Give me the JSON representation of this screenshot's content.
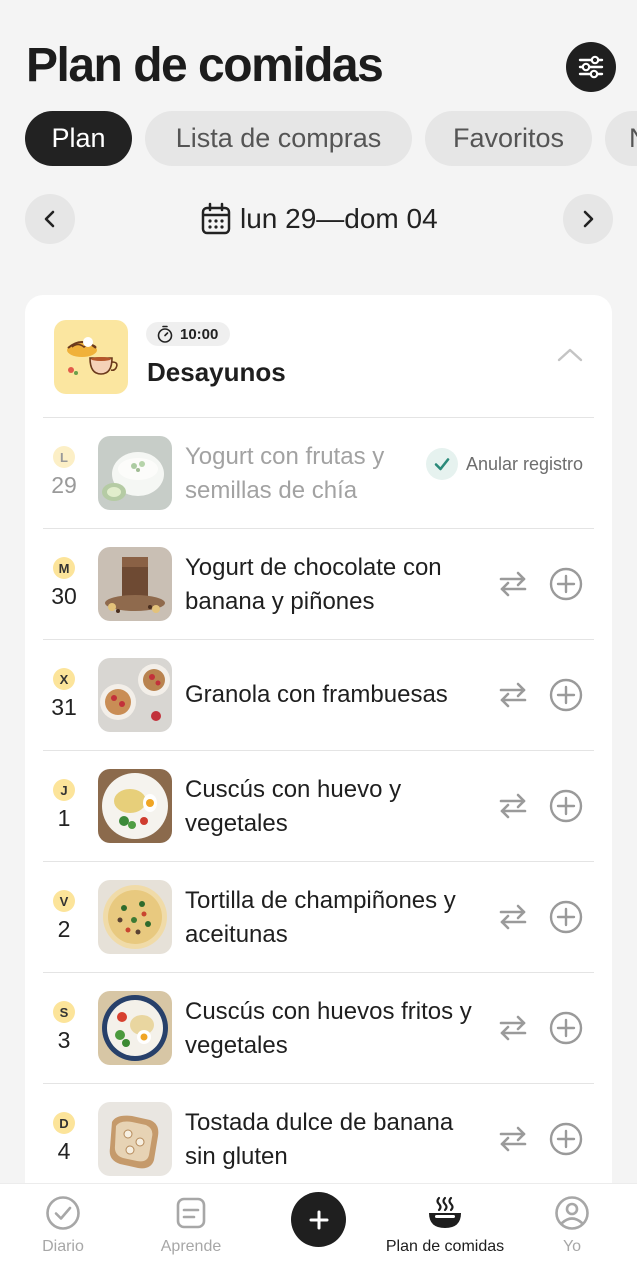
{
  "header": {
    "title": "Plan de comidas",
    "filter_icon": "sliders-icon"
  },
  "tabs": [
    {
      "label": "Plan",
      "active": true
    },
    {
      "label": "Lista de compras",
      "active": false
    },
    {
      "label": "Favoritos",
      "active": false
    },
    {
      "label": "N",
      "active": false
    }
  ],
  "week": {
    "label": "lun 29—dom 04",
    "icon": "calendar-icon"
  },
  "meal": {
    "time": "10:00",
    "name": "Desayunos",
    "icon": "breakfast-illustration"
  },
  "rows": [
    {
      "day": "L",
      "num": "29",
      "name": "Yogurt con frutas y semillas de chía",
      "logged": true,
      "undo_label": "Anular registro"
    },
    {
      "day": "M",
      "num": "30",
      "name": "Yogurt de chocolate con banana y piñones",
      "logged": false
    },
    {
      "day": "X",
      "num": "31",
      "name": "Granola con frambuesas",
      "logged": false
    },
    {
      "day": "J",
      "num": "1",
      "name": "Cuscús con huevo y vegetales",
      "logged": false
    },
    {
      "day": "V",
      "num": "2",
      "name": "Tortilla de champiñones y aceitunas",
      "logged": false
    },
    {
      "day": "S",
      "num": "3",
      "name": "Cuscús con huevos fritos y vegetales",
      "logged": false
    },
    {
      "day": "D",
      "num": "4",
      "name": "Tostada dulce de banana sin gluten",
      "logged": false
    }
  ],
  "bottom_nav": [
    {
      "label": "Diario",
      "icon": "check-circle-icon",
      "active": false
    },
    {
      "label": "Aprende",
      "icon": "document-icon",
      "active": false
    },
    {
      "label": "Plan de comidas",
      "icon": "food-bowl-icon",
      "active": true
    },
    {
      "label": "Yo",
      "icon": "profile-icon",
      "active": false
    }
  ],
  "colors": {
    "accent": "#1f1f1f",
    "day_badge": "#fce49a",
    "check": "#2b8a7a"
  }
}
